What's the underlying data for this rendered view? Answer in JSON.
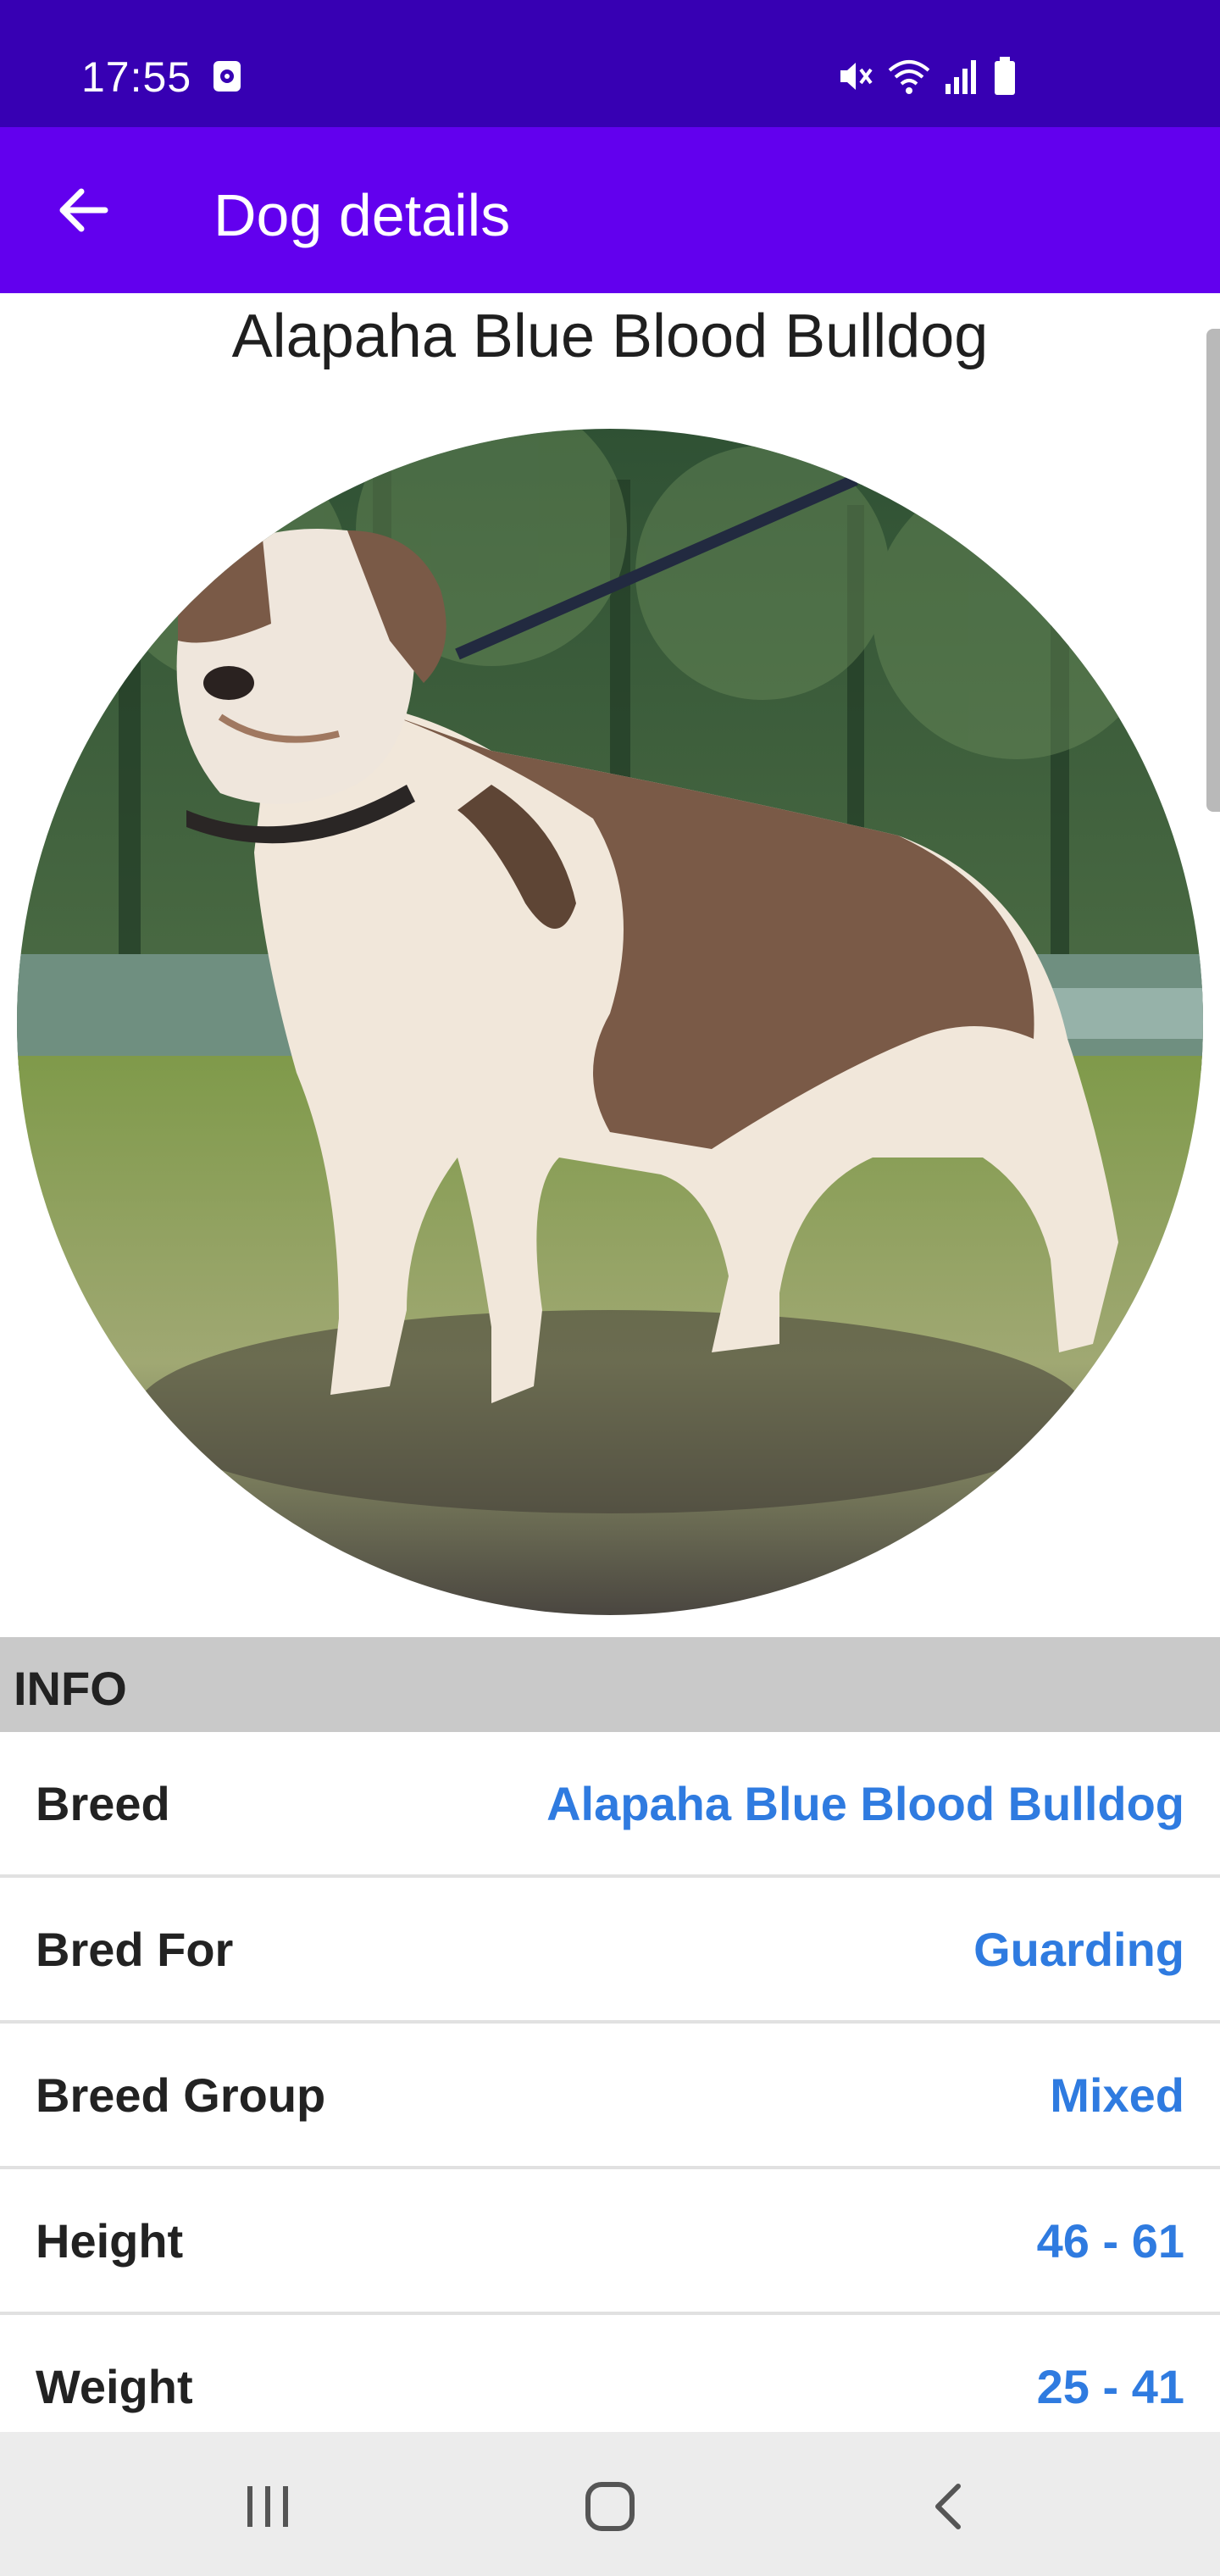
{
  "status_bar": {
    "time": "17:55",
    "left_icons": [
      "screen-record-icon"
    ],
    "right_icons": [
      "mute-icon",
      "wifi-icon",
      "signal-icon",
      "battery-icon"
    ]
  },
  "app_bar": {
    "title": "Dog details",
    "back_icon": "arrow-back-icon"
  },
  "dog": {
    "name": "Alapaha Blue Blood Bulldog",
    "photo": "dog-photo"
  },
  "info": {
    "header": "INFO",
    "rows": [
      {
        "label": "Breed",
        "value": "Alapaha Blue Blood Bulldog"
      },
      {
        "label": "Bred For",
        "value": "Guarding"
      },
      {
        "label": "Breed Group",
        "value": "Mixed"
      },
      {
        "label": "Height",
        "value": "46 - 61"
      },
      {
        "label": "Weight",
        "value": "25 - 41"
      }
    ]
  },
  "nav_bar": {
    "icons": [
      "recent-apps-icon",
      "home-icon",
      "back-icon"
    ]
  },
  "colors": {
    "status_bar": "#3700b3",
    "app_bar": "#6200ee",
    "value_text": "#2f7be0",
    "section_header": "#c9c9c9"
  }
}
